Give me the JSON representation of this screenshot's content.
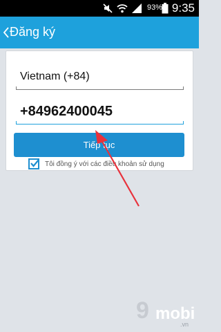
{
  "status_bar": {
    "battery_percent": "93%",
    "time": "9:35"
  },
  "app_bar": {
    "title": "Đăng ký"
  },
  "form": {
    "country_value": "Vietnam (+84)",
    "phone_value": "+84962400045",
    "continue_label": "Tiếp tục",
    "terms_label": "Tôi đồng ý với các điều khoản sử dụng",
    "terms_checked": true
  },
  "watermark": {
    "logo_digit": "9",
    "logo_word": "mobi",
    "logo_domain": ".vn"
  },
  "colors": {
    "accent": "#1ea1dc",
    "button": "#1e8fd0",
    "background": "#dfe3e8",
    "annotation_arrow": "#e8323c"
  }
}
